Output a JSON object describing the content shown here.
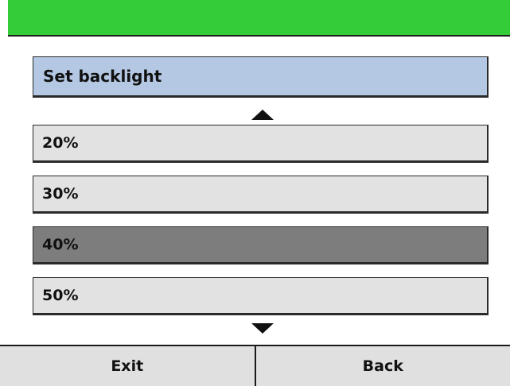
{
  "status_bar": {
    "color": "#35cc3a"
  },
  "menu": {
    "title": "Set backlight",
    "scroll_up_icon": "triangle-up-icon",
    "scroll_down_icon": "triangle-down-icon",
    "items": [
      {
        "label": "20%",
        "selected": false
      },
      {
        "label": "30%",
        "selected": false
      },
      {
        "label": "40%",
        "selected": true
      },
      {
        "label": "50%",
        "selected": false
      }
    ]
  },
  "softkeys": {
    "left_label": "Exit",
    "right_label": "Back"
  },
  "colors": {
    "title_bg": "#b4c8e3",
    "item_bg": "#e2e2e2",
    "selected_bg": "#7d7d7d",
    "softkey_bg": "#e0e0e0"
  }
}
